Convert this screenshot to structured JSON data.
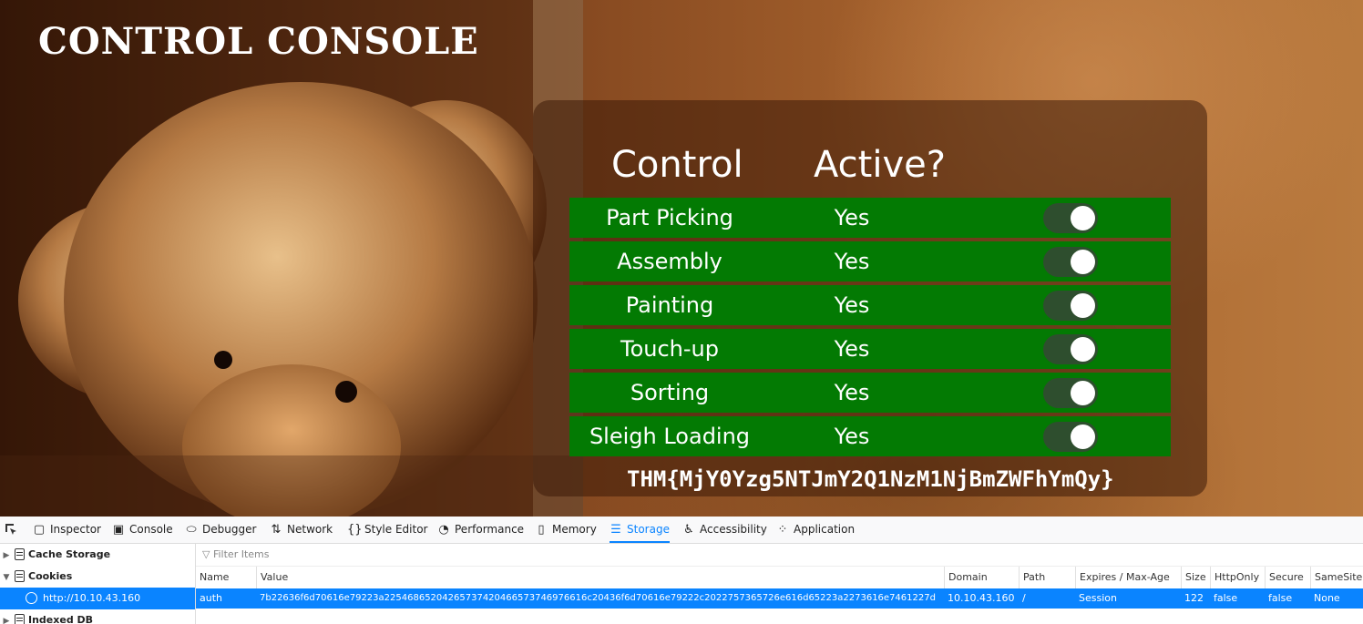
{
  "page": {
    "title": "CONTROL CONSOLE",
    "table_headers": {
      "control": "Control",
      "active": "Active?"
    },
    "controls": [
      {
        "label": "Part Picking",
        "active": "Yes"
      },
      {
        "label": "Assembly",
        "active": "Yes"
      },
      {
        "label": "Painting",
        "active": "Yes"
      },
      {
        "label": "Touch-up",
        "active": "Yes"
      },
      {
        "label": "Sorting",
        "active": "Yes"
      },
      {
        "label": "Sleigh Loading",
        "active": "Yes"
      }
    ],
    "flag": "THM{MjY0Yzg5NTJmY2Q1NzM1NjBmZWFhYmQy}",
    "row_color": "#037a03"
  },
  "devtools": {
    "tabs": [
      {
        "label": "Inspector",
        "icon": "inspector-icon"
      },
      {
        "label": "Console",
        "icon": "console-icon"
      },
      {
        "label": "Debugger",
        "icon": "debugger-icon"
      },
      {
        "label": "Network",
        "icon": "network-icon"
      },
      {
        "label": "Style Editor",
        "icon": "style-editor-icon"
      },
      {
        "label": "Performance",
        "icon": "performance-icon"
      },
      {
        "label": "Memory",
        "icon": "memory-icon"
      },
      {
        "label": "Storage",
        "icon": "storage-icon",
        "active": true
      },
      {
        "label": "Accessibility",
        "icon": "accessibility-icon"
      },
      {
        "label": "Application",
        "icon": "application-icon"
      }
    ],
    "sidebar": {
      "cache_storage": "Cache Storage",
      "cookies": "Cookies",
      "cookie_host": "http://10.10.43.160",
      "indexed_db": "Indexed DB"
    },
    "filter_placeholder": "Filter Items",
    "columns": [
      "Name",
      "Value",
      "Domain",
      "Path",
      "Expires / Max-Age",
      "Size",
      "HttpOnly",
      "Secure",
      "SameSite"
    ],
    "cookie": {
      "name": "auth",
      "value": "7b22636f6d70616e79223a22546865204265737420466573746976616c20436f6d70616e79222c2022757365726e616d65223a2273616e7461227d",
      "domain": "10.10.43.160",
      "path": "/",
      "expires": "Session",
      "size": "122",
      "httponly": "false",
      "secure": "false",
      "samesite": "None"
    },
    "accent_color": "#0a84ff"
  }
}
